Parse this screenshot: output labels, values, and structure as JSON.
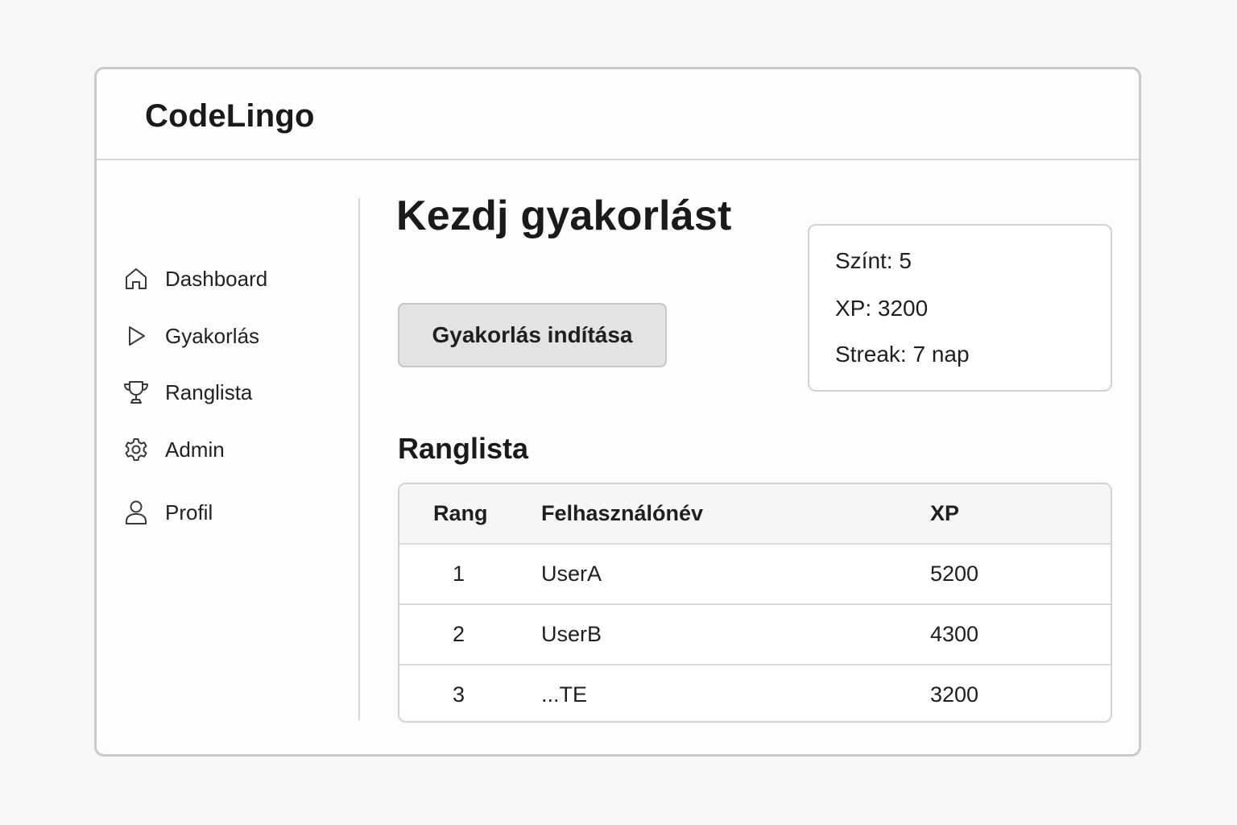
{
  "app": {
    "title": "CodeLingo"
  },
  "sidebar": {
    "items": [
      {
        "label": "Dashboard",
        "icon": "home-icon"
      },
      {
        "label": "Gyakorlás",
        "icon": "play-icon"
      },
      {
        "label": "Ranglista",
        "icon": "trophy-icon"
      },
      {
        "label": "Admin",
        "icon": "gear-icon"
      },
      {
        "label": "Profil",
        "icon": "user-icon"
      }
    ]
  },
  "main": {
    "title": "Kezdj gyakorlást",
    "start_button_label": "Gyakorlás indítása",
    "stats": {
      "level": "Színt: 5",
      "xp": "XP: 3200",
      "streak": "Streak: 7 nap"
    },
    "leaderboard": {
      "title": "Ranglista",
      "columns": [
        "Rang",
        "Felhasználónév",
        "XP"
      ],
      "rows": [
        {
          "rank": "1",
          "user": "UserA",
          "xp": "5200"
        },
        {
          "rank": "2",
          "user": "UserB",
          "xp": "4300"
        },
        {
          "rank": "3",
          "user": "...TE",
          "xp": "3200"
        }
      ]
    }
  },
  "colors": {
    "background": "#f7f7f7",
    "window": "#fdfdfd",
    "border": "#c9c9c9",
    "button": "#e3e3e3",
    "text": "#1c1c1c"
  }
}
